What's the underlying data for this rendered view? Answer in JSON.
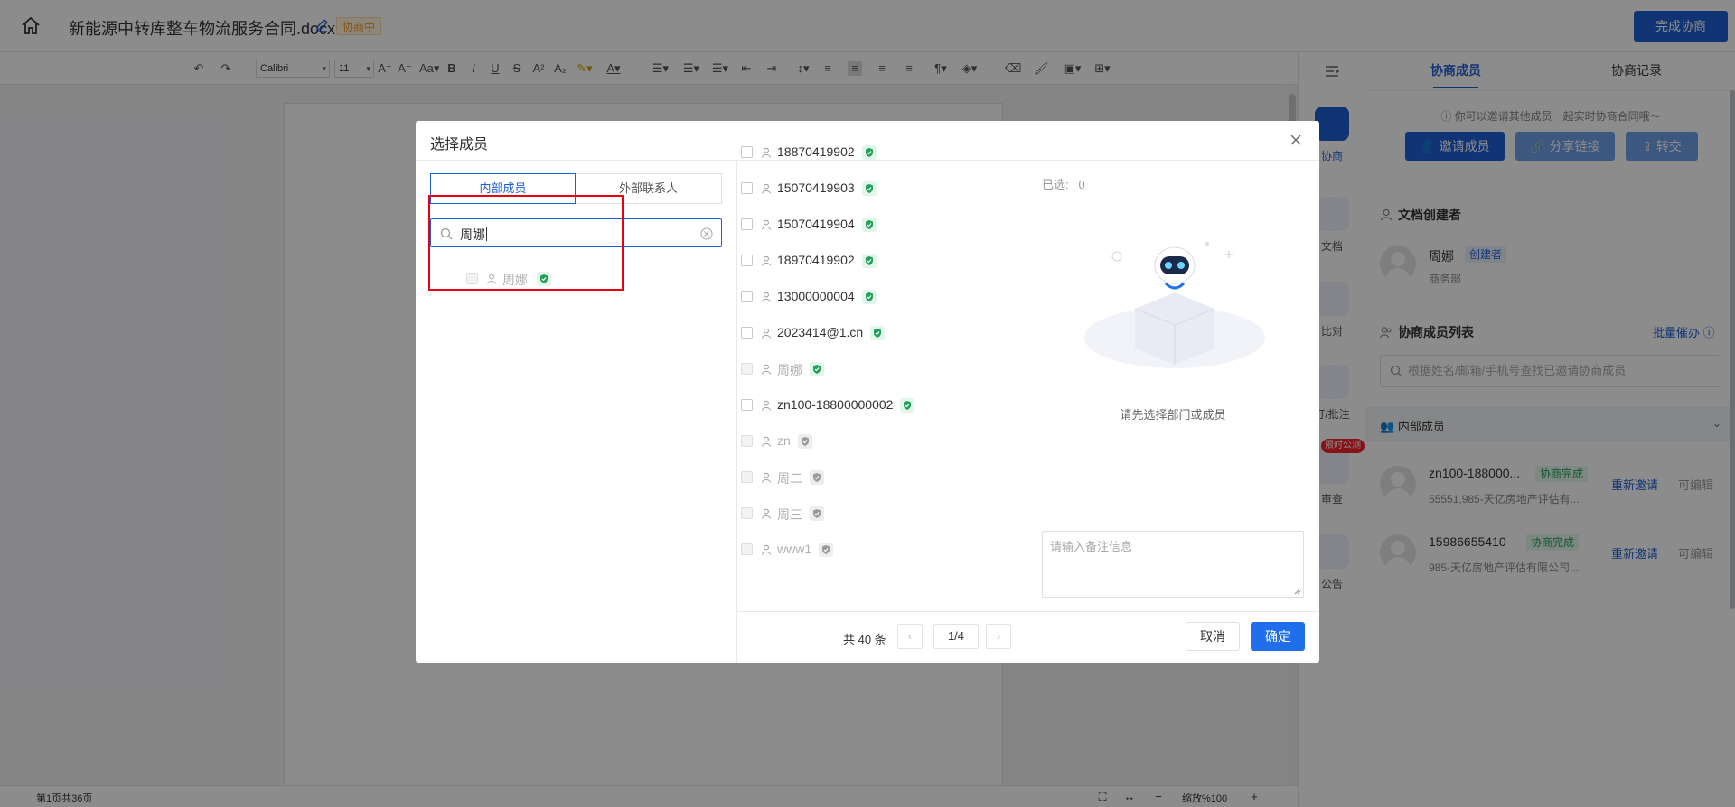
{
  "header": {
    "title": "新能源中转库整车物流服务合同.docx",
    "status": "协商中",
    "finish_button": "完成协商",
    "icons": [
      "home-icon",
      "edit-icon"
    ]
  },
  "toolbar": {
    "font_family": "Calibri",
    "font_size": "11"
  },
  "statusbar": {
    "page_info": "第1页共36页",
    "zoom": "缩放%100"
  },
  "rail": {
    "items": [
      {
        "label": "协商",
        "icon": "collaborate-icon"
      },
      {
        "label": "文档",
        "icon": "document-icon"
      },
      {
        "label": "比对",
        "icon": "compare-icon"
      },
      {
        "label": "订/批注",
        "icon": "annotate-icon"
      },
      {
        "label": "审查",
        "icon": "review-icon"
      },
      {
        "label": "公告",
        "icon": "notice-icon"
      }
    ],
    "badge": "限时公测"
  },
  "panel": {
    "tabs": [
      "协商成员",
      "协商记录"
    ],
    "tip": "你可以邀请其他成员一起实时协商合同哦～",
    "buttons": {
      "invite": "邀请成员",
      "share": "分享链接",
      "transfer": "转交"
    },
    "creator_section": "文档创建者",
    "creator": {
      "name": "周娜",
      "tag": "创建者",
      "dept": "商务部"
    },
    "list_section": "协商成员列表",
    "batch_remind": "批量催办",
    "search_placeholder": "根据姓名/邮箱/手机号查找已邀请协商成员",
    "group": "内部成员",
    "members": [
      {
        "name": "zn100-188000...",
        "tag": "协商完成",
        "sub": "55551,985-天亿房地产评估有...",
        "reinvite": "重新邀请",
        "edit": "可编辑"
      },
      {
        "name": "15986655410",
        "tag": "协商完成",
        "sub": "985-天亿房地产评估有限公司,...",
        "reinvite": "重新邀请",
        "edit": "可编辑"
      }
    ]
  },
  "modal": {
    "title": "选择成员",
    "tabs": {
      "internal": "内部成员",
      "external": "外部联系人"
    },
    "search_value": "周娜",
    "search_result": "周娜",
    "list": [
      {
        "name": "18870419902",
        "enabled": true
      },
      {
        "name": "15070419903",
        "enabled": true
      },
      {
        "name": "15070419904",
        "enabled": true
      },
      {
        "name": "18970419902",
        "enabled": true
      },
      {
        "name": "13000000004",
        "enabled": true
      },
      {
        "name": "2023414@1.cn",
        "enabled": true
      },
      {
        "name": "周娜",
        "enabled": false
      },
      {
        "name": "zn100-18800000002",
        "enabled": true
      },
      {
        "name": "zn",
        "enabled": false
      },
      {
        "name": "周二",
        "enabled": false
      },
      {
        "name": "周三",
        "enabled": false
      },
      {
        "name": "www1",
        "enabled": false
      }
    ],
    "selected_label": "已选:",
    "selected_count": "0",
    "empty_text": "请先选择部门或成员",
    "remark_placeholder": "请输入备注信息",
    "total": "共 40 条",
    "page": "1/4",
    "cancel": "取消",
    "confirm": "确定"
  },
  "colors": {
    "primary": "#1f5fd6",
    "status": "#f59a23",
    "success": "#23a05a",
    "highlight": "#e60012"
  }
}
